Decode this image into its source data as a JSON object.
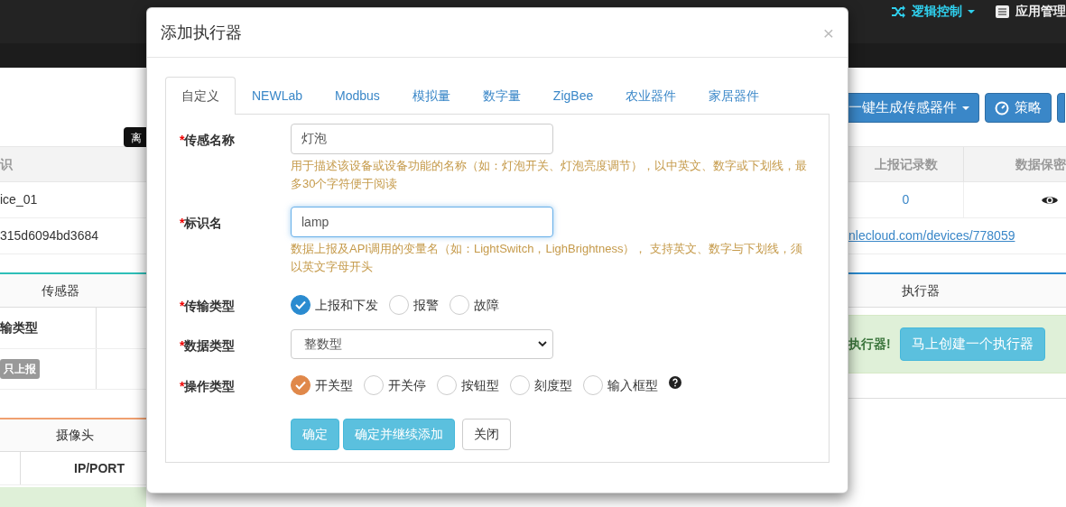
{
  "nav": {
    "items": [
      {
        "label": "逻辑控制",
        "kind": "dropdown"
      },
      {
        "label": "应用管理",
        "kind": "link"
      }
    ]
  },
  "left_strip": {
    "tooltip": "离",
    "table_header": "识",
    "rows": [
      "ice_01",
      "315d6094bd3684"
    ],
    "sensor_panel": {
      "title": "传感器",
      "column": "输类型",
      "badge": "只上报"
    },
    "camera_panel": {
      "title": "摄像头",
      "column": "IP/PORT"
    }
  },
  "right_strip": {
    "buttons": [
      {
        "label": "一键生成传感器件",
        "kind": "dropdown"
      },
      {
        "label": "策略",
        "kind": "button"
      }
    ],
    "table": {
      "columns": [
        "上报记录数",
        "数据保密"
      ],
      "count": "0",
      "link": "nlecloud.com/devices/778059"
    },
    "actuator_panel": {
      "title": "执行器",
      "alert": "执行器!",
      "button": "马上创建一个执行器"
    }
  },
  "modal": {
    "title": "添加执行器",
    "close": "×",
    "tabs": [
      {
        "label": "自定义",
        "selected": true
      },
      {
        "label": "NEWLab",
        "selected": false
      },
      {
        "label": "Modbus",
        "selected": false
      },
      {
        "label": "模拟量",
        "selected": false
      },
      {
        "label": "数字量",
        "selected": false
      },
      {
        "label": "ZigBee",
        "selected": false
      },
      {
        "label": "农业器件",
        "selected": false
      },
      {
        "label": "家居器件",
        "selected": false
      }
    ],
    "fields": [
      {
        "kind": "text",
        "marker": "*",
        "label": "传感名称",
        "value": "灯泡",
        "focused": false,
        "help": "用于描述该设备或设备功能的名称（如：灯泡开关、灯泡亮度调节），以中英文、数字或下划线，最多30个字符便于阅读"
      },
      {
        "kind": "text",
        "marker": "*",
        "label": "标识名",
        "value": "lamp",
        "focused": true,
        "help": "数据上报及API调用的变量名（如：LightSwitch，LighBrightness）， 支持英文、数字与下划线，须以英文字母开头"
      },
      {
        "kind": "radio",
        "marker": "*",
        "label": "传输类型",
        "color": "#2a8bd0",
        "hint_icon": false,
        "options": [
          {
            "label": "上报和下发",
            "selected": true
          },
          {
            "label": "报警",
            "selected": false
          },
          {
            "label": "故障",
            "selected": false
          }
        ]
      },
      {
        "kind": "select",
        "marker": "*",
        "label": "数据类型",
        "value": "整数型"
      },
      {
        "kind": "radio",
        "marker": "*",
        "label": "操作类型",
        "color": "#e0884a",
        "hint_icon": true,
        "options": [
          {
            "label": "开关型",
            "selected": true
          },
          {
            "label": "开关停",
            "selected": false
          },
          {
            "label": "按钮型",
            "selected": false
          },
          {
            "label": "刻度型",
            "selected": false
          },
          {
            "label": "输入框型",
            "selected": false
          }
        ]
      }
    ],
    "buttons": [
      {
        "label": "确定",
        "kind": "primary"
      },
      {
        "label": "确定并继续添加",
        "kind": "primary"
      },
      {
        "label": "关闭",
        "kind": "default"
      }
    ]
  }
}
